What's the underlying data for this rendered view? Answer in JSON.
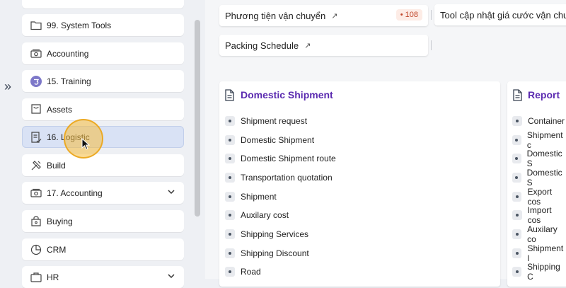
{
  "sidebar": {
    "items": [
      {
        "label": "",
        "icon": "blank"
      },
      {
        "label": "99. System Tools",
        "icon": "folder-icon"
      },
      {
        "label": "Accounting",
        "icon": "accounting-icon"
      },
      {
        "label": "15. Training",
        "icon": "training-icon"
      },
      {
        "label": "Assets",
        "icon": "assets-icon"
      },
      {
        "label": "16. Logistic",
        "icon": "logistic-icon",
        "active": true
      },
      {
        "label": "Build",
        "icon": "build-icon"
      },
      {
        "label": "17. Accounting",
        "icon": "accounting-icon",
        "expandable": true
      },
      {
        "label": "Buying",
        "icon": "buying-icon"
      },
      {
        "label": "CRM",
        "icon": "crm-icon"
      },
      {
        "label": "HR",
        "icon": "hr-icon",
        "expandable": true
      }
    ],
    "collapse_glyph": "»"
  },
  "shortcuts": {
    "transport": {
      "label": "Phương tiện vận chuyển",
      "arrow": "↗",
      "badge": "• 108"
    },
    "tool": {
      "label": "Tool cập nhật giá cước vận chuy"
    },
    "packing": {
      "label": "Packing Schedule",
      "arrow": "↗"
    }
  },
  "panels": {
    "domestic": {
      "title": "Domestic Shipment",
      "items": [
        "Shipment request",
        "Domestic Shipment",
        "Domestic Shipment route",
        "Transportation quotation",
        "Shipment",
        "Auxilary cost",
        "Shipping Services",
        "Shipping Discount",
        "Road"
      ]
    },
    "report": {
      "title": "Report",
      "items": [
        "Container",
        "Shipment c",
        "Domestic S",
        "Domestic S",
        "Export cos",
        "Import cos",
        "Auxilary co",
        "Shipment l",
        "Shipping C"
      ]
    }
  },
  "colors": {
    "accent": "#5b2bb0",
    "active_item": "#d9e2f5",
    "badge_bg": "#fdece6",
    "badge_text": "#c0452a",
    "cursor_highlight": "#f5bc3c"
  }
}
